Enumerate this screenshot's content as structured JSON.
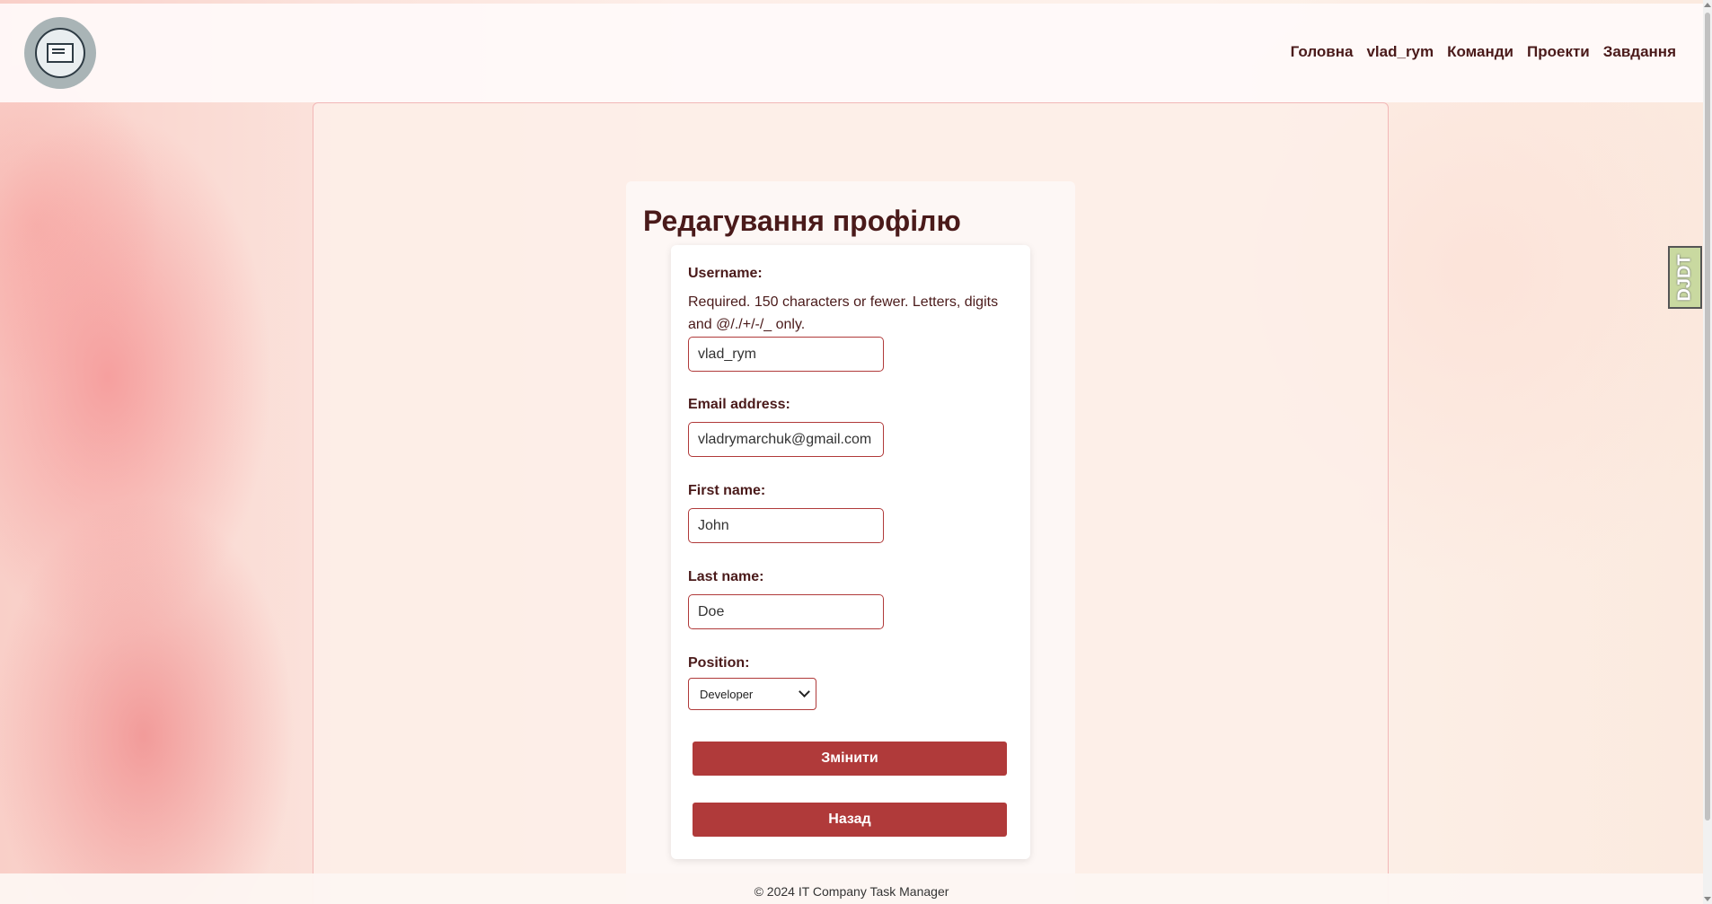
{
  "nav": {
    "items": [
      "Головна",
      "vlad_rym",
      "Команди",
      "Проекти",
      "Завдання"
    ]
  },
  "page": {
    "title": "Редагування профілю"
  },
  "form": {
    "username_label": "Username:",
    "username_help": "Required. 150 characters or fewer. Letters, digits and @/./+/-/_ only.",
    "username_value": "vlad_rym",
    "email_label": "Email address:",
    "email_value": "vladrymarchuk@gmail.com",
    "first_name_label": "First name:",
    "first_name_value": "John",
    "last_name_label": "Last name:",
    "last_name_value": "Doe",
    "position_label": "Position:",
    "position_value": "Developer",
    "submit_label": "Змінити",
    "back_label": "Назад"
  },
  "footer": {
    "text": "© 2024 IT Company Task Manager"
  },
  "debug_toolbar": {
    "label": "DJDT"
  },
  "colors": {
    "accent": "#b03a3a",
    "text": "#4a1a1a"
  }
}
